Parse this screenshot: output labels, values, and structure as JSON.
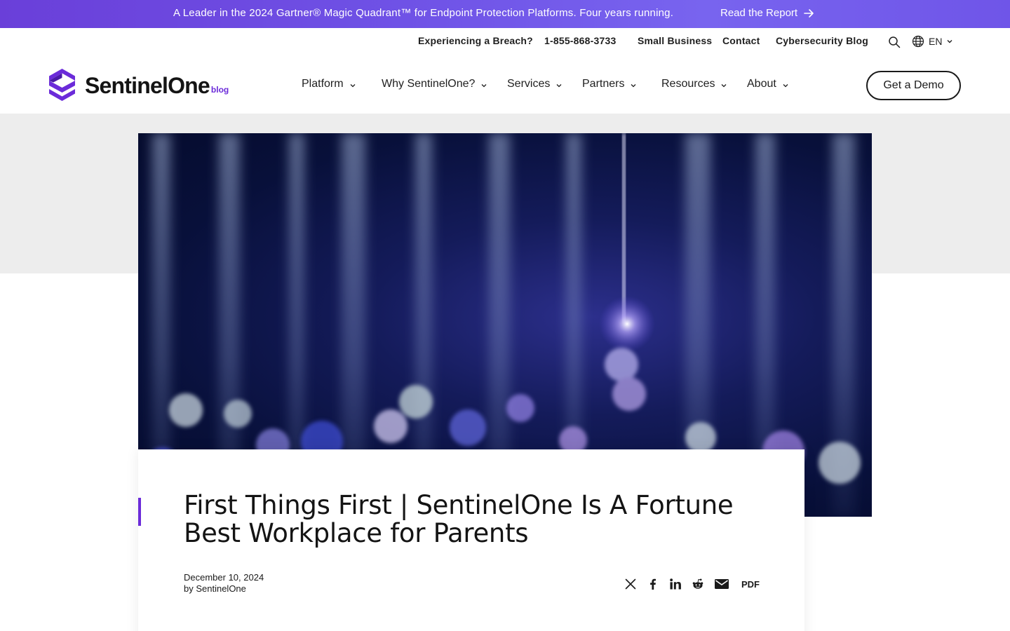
{
  "banner": {
    "text": "A Leader in the 2024 Gartner® Magic Quadrant™ for Endpoint Protection Platforms. Four years running.",
    "link_label": "Read the Report",
    "icon": "arrow-right-icon"
  },
  "utility": {
    "breach": "Experiencing a Breach?",
    "phone": "1-855-868-3733",
    "small_business": "Small Business",
    "contact": "Contact",
    "blog": "Cybersecurity Blog",
    "search_icon": "search-icon",
    "language": "EN",
    "language_icon": "globe-icon"
  },
  "logo": {
    "wordmark": "SentinelOne",
    "suffix": "blog",
    "brand_color": "#6b2bd9"
  },
  "nav": {
    "items": [
      {
        "label": "Platform"
      },
      {
        "label": "Why SentinelOne?"
      },
      {
        "label": "Services"
      },
      {
        "label": "Partners"
      },
      {
        "label": "Resources"
      },
      {
        "label": "About"
      }
    ],
    "cta": "Get a Demo"
  },
  "article": {
    "title": "First Things First | SentinelOne Is A Fortune Best Workplace for Parents",
    "date": "December 10, 2024",
    "byline": "by SentinelOne",
    "share": {
      "icons": [
        "x-icon",
        "facebook-icon",
        "linkedin-icon",
        "reddit-icon",
        "email-icon"
      ],
      "pdf_label": "PDF"
    },
    "accent_color": "#6b2bd9"
  },
  "colors": {
    "banner_start": "#6a3fd9",
    "banner_end": "#7864ef",
    "gray_band": "#ededed"
  }
}
